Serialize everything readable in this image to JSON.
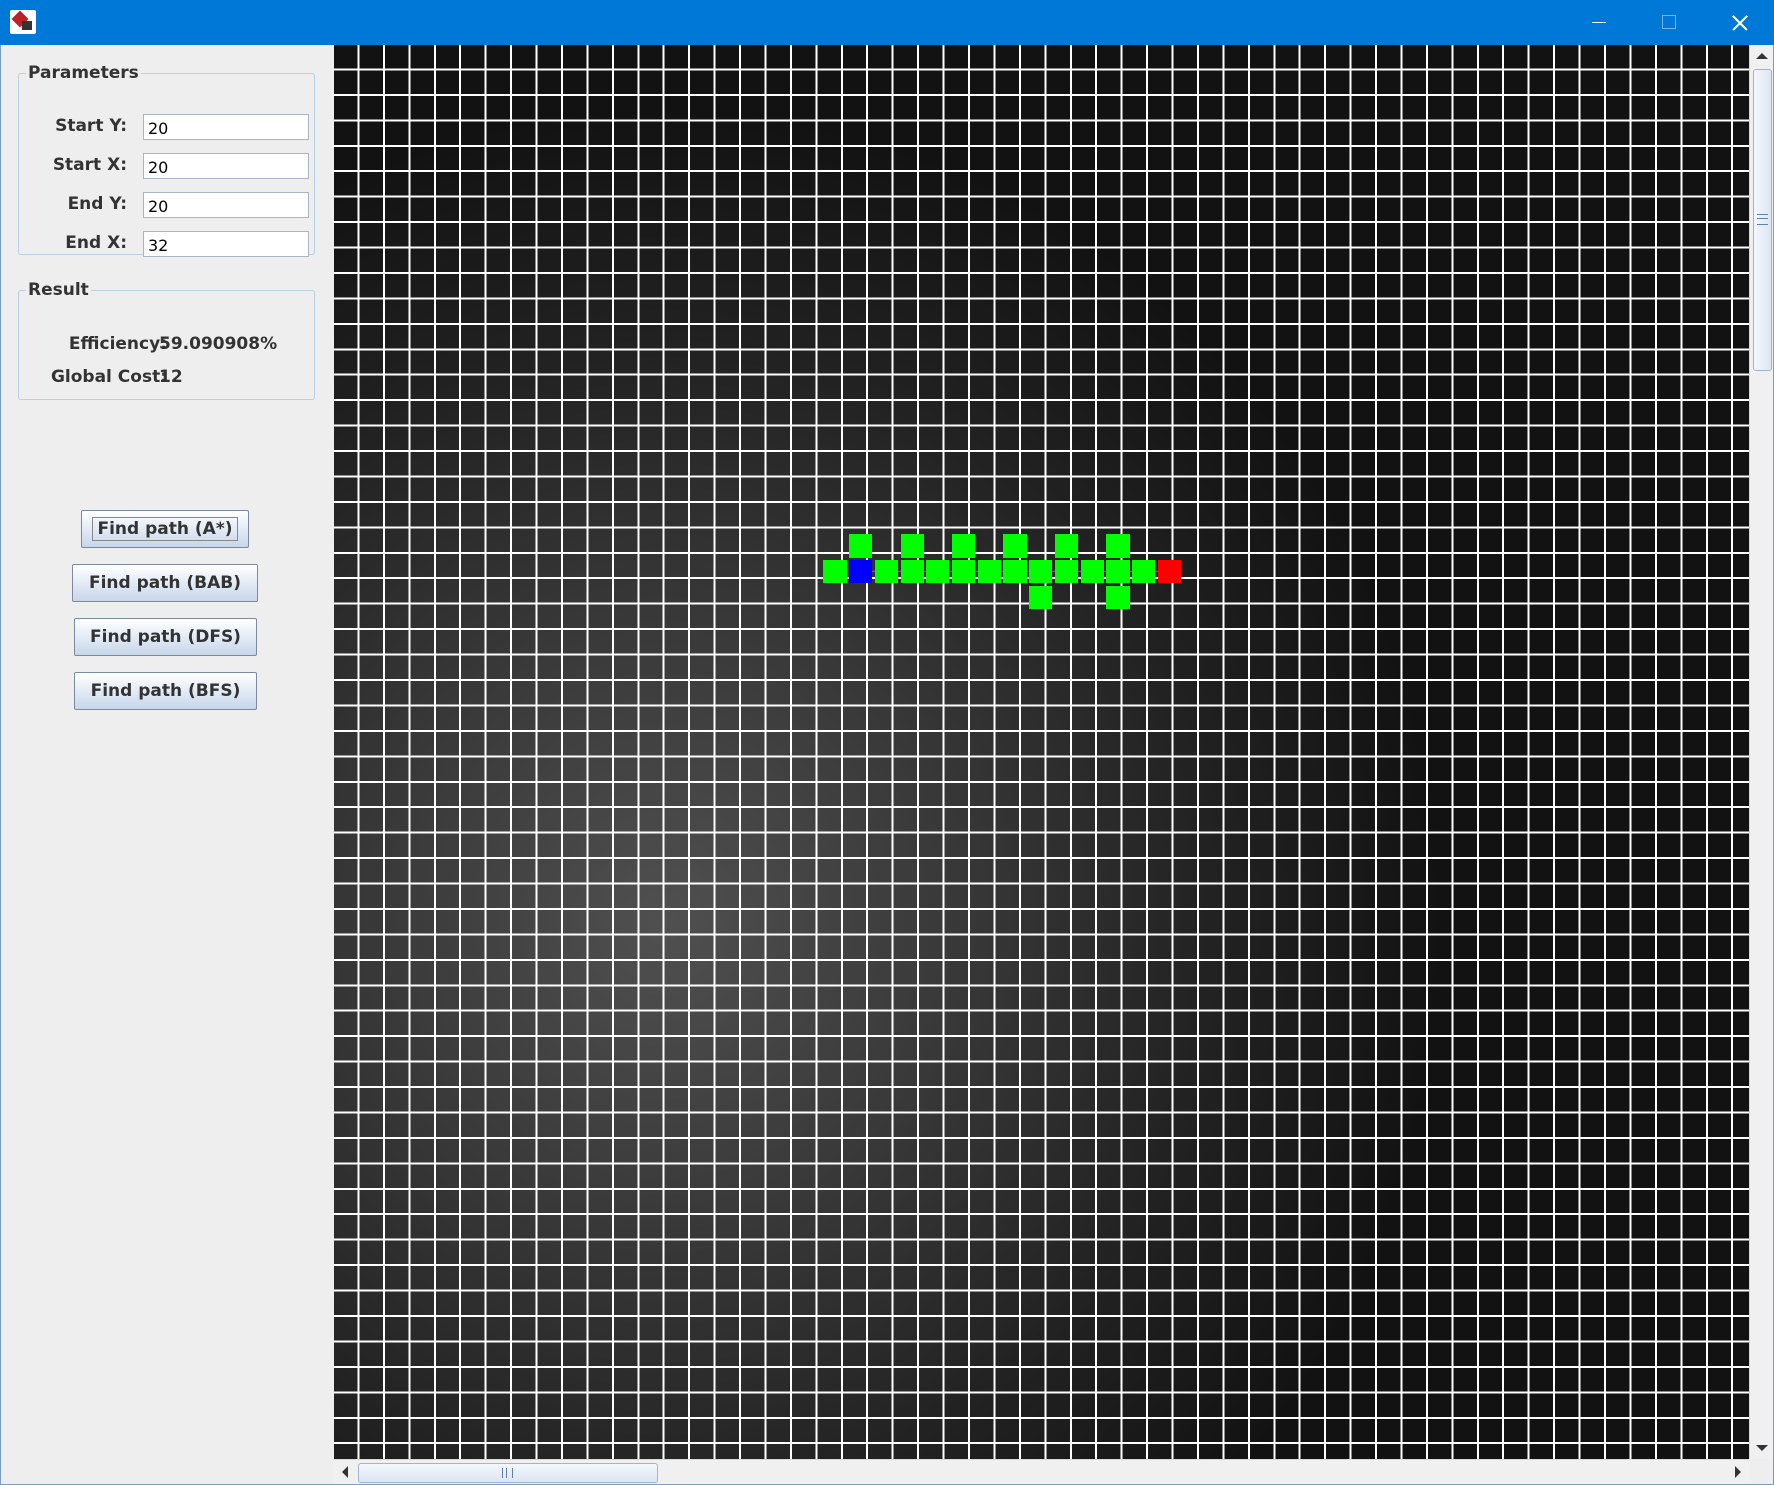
{
  "window": {
    "title": "",
    "icons": {
      "app": "app-icon",
      "minimize": "minimize-icon",
      "maximize": "maximize-icon",
      "close": "close-icon"
    },
    "colors": {
      "titlebar": "#0078d7",
      "panel": "#eeeeee"
    }
  },
  "parameters": {
    "title": "Parameters",
    "fields": [
      {
        "label": "Start Y:",
        "value": "20"
      },
      {
        "label": "Start X:",
        "value": "20"
      },
      {
        "label": "End Y:",
        "value": "20"
      },
      {
        "label": "End X:",
        "value": "32"
      }
    ]
  },
  "result": {
    "title": "Result",
    "efficiency_label": "Efficiency:",
    "efficiency_value": "59.090908%",
    "cost_label": "Global Cost:",
    "cost_value": "12"
  },
  "buttons": {
    "astar": "Find path (A*)",
    "bab": "Find path (BAB)",
    "dfs": "Find path (DFS)",
    "bfs": "Find path (BFS)"
  },
  "grid": {
    "visible_columns": 55,
    "visible_rows": 55,
    "start_cell": {
      "row": 20,
      "col": 20
    },
    "end_cell": {
      "row": 20,
      "col": 32
    },
    "path_cells": [
      [
        20,
        21
      ],
      [
        20,
        22
      ],
      [
        20,
        23
      ],
      [
        20,
        24
      ],
      [
        20,
        25
      ],
      [
        20,
        26
      ],
      [
        20,
        27
      ],
      [
        20,
        28
      ],
      [
        20,
        29
      ],
      [
        20,
        30
      ],
      [
        20,
        31
      ]
    ],
    "explored_cells": [
      [
        19,
        20
      ],
      [
        19,
        22
      ],
      [
        19,
        24
      ],
      [
        19,
        26
      ],
      [
        19,
        28
      ],
      [
        19,
        30
      ],
      [
        20,
        19
      ],
      [
        21,
        27
      ],
      [
        21,
        30
      ]
    ],
    "colors": {
      "start": "#0000ff",
      "end": "#ff0000",
      "explored": "#00ff00",
      "path_line": "#c020c0",
      "grid_line": "#ffffff"
    }
  }
}
